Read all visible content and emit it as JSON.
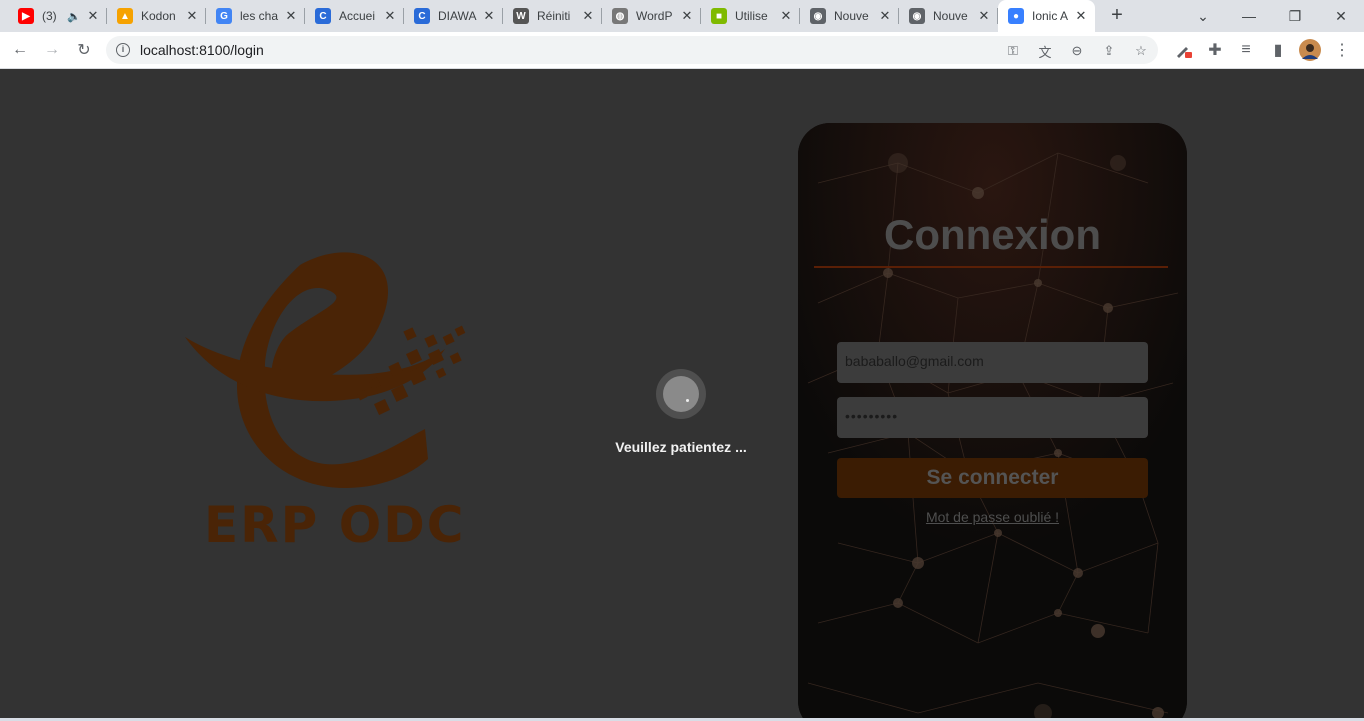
{
  "browser": {
    "tabs": [
      {
        "title": "(3)",
        "favicon": "youtube-icon",
        "color": "#ff0000",
        "glyph": "▶",
        "muted": true
      },
      {
        "title": "Kodon",
        "favicon": "firebase-icon",
        "color": "#f6a200",
        "glyph": "▲"
      },
      {
        "title": "les cha",
        "favicon": "google-icon",
        "color": "#4285f4",
        "glyph": "G"
      },
      {
        "title": "Accuei",
        "favicon": "edge-c-icon",
        "color": "#2a6bd8",
        "glyph": "C"
      },
      {
        "title": "DIAWA",
        "favicon": "edge-c-icon",
        "color": "#2a6bd8",
        "glyph": "C"
      },
      {
        "title": "Réiniti",
        "favicon": "wordpress-icon",
        "color": "#555555",
        "glyph": "W"
      },
      {
        "title": "WordP",
        "favicon": "globe-icon",
        "color": "#777777",
        "glyph": "◍"
      },
      {
        "title": "Utilise",
        "favicon": "microsoft-icon",
        "color": "#7fba00",
        "glyph": "■"
      },
      {
        "title": "Nouve",
        "favicon": "chrome-icon",
        "color": "#5f6368",
        "glyph": "◉"
      },
      {
        "title": "Nouve",
        "favicon": "chrome-icon",
        "color": "#5f6368",
        "glyph": "◉"
      },
      {
        "title": "Ionic A",
        "favicon": "ionic-icon",
        "color": "#3880ff",
        "glyph": "●",
        "active": true
      }
    ],
    "url": "localhost:8100/login"
  },
  "login": {
    "title": "Connexion",
    "email": "bababallo@gmail.com",
    "password_mask": "•••••••••",
    "submit": "Se connecter",
    "forgot": "Mot de passe oublié !"
  },
  "logo": {
    "name": "ERP ODC",
    "color": "#4a2406"
  },
  "loader": {
    "text": "Veuillez patientez ..."
  }
}
